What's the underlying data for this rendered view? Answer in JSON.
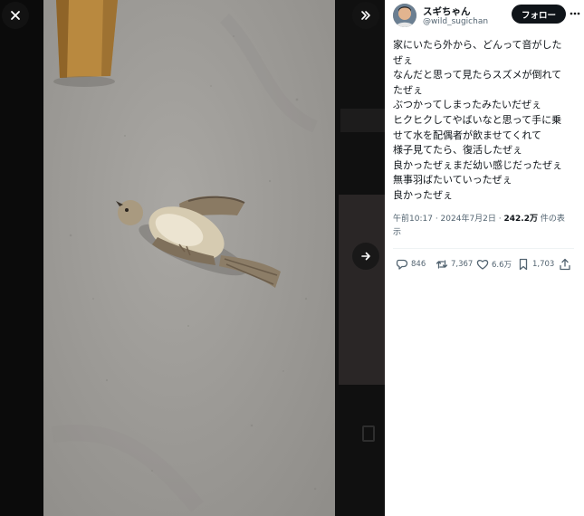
{
  "viewer": {
    "icons": {
      "close": "close-icon",
      "expand": "expand-icon",
      "next": "chevron-right-icon"
    }
  },
  "tweet": {
    "author_name": "スギちゃん",
    "author_handle": "@wild_sugichan",
    "follow_label": "フォロー",
    "more_icon": "more-icon",
    "lines": [
      "家にいたら外から、どんって音がした",
      "ぜぇ",
      "なんだと思って見たらスズメが倒れて",
      "たぜぇ",
      "ぶつかってしまったみたいだぜぇ",
      "ヒクヒクしてやばいなと思って手に乗",
      "せて水を配偶者が飲ませてくれて",
      "様子見てたら、復活したぜぇ",
      "良かったぜぇまだ幼い感じだったぜぇ",
      "無事羽ばたいていったぜぇ",
      "良かったぜぇ"
    ],
    "time": "午前10:17",
    "date": "2024年7月2日",
    "views_count": "242.2万",
    "views_label_1": "件の表",
    "views_label_2": "示",
    "stats": {
      "replies": "846",
      "reposts": "7,367",
      "likes": "6.6万",
      "bookmarks": "1,703"
    }
  },
  "colors": {
    "panel_bg": "#ffffff",
    "text": "#0f1419",
    "muted": "#536471",
    "follow_bg": "#0f1419"
  }
}
